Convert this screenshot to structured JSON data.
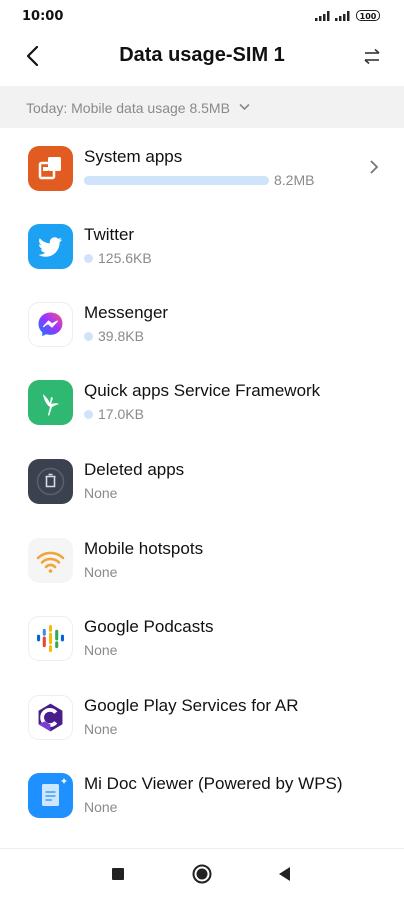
{
  "status_bar": {
    "time": "10:00",
    "battery": "100"
  },
  "header": {
    "title": "Data usage-SIM 1"
  },
  "summary": {
    "text": "Today: Mobile data usage 8.5MB"
  },
  "apps": [
    {
      "name": "System apps",
      "usage": "8.2MB",
      "icon": "system-apps-icon",
      "bar_fraction": 1.0
    },
    {
      "name": "Twitter",
      "usage": "125.6KB",
      "icon": "twitter-icon"
    },
    {
      "name": "Messenger",
      "usage": "39.8KB",
      "icon": "messenger-icon"
    },
    {
      "name": "Quick apps Service Framework",
      "usage": "17.0KB",
      "icon": "quick-apps-icon"
    },
    {
      "name": "Deleted apps",
      "usage": "None",
      "icon": "trash-icon"
    },
    {
      "name": "Mobile hotspots",
      "usage": "None",
      "icon": "wifi-hotspot-icon"
    },
    {
      "name": "Google Podcasts",
      "usage": "None",
      "icon": "google-podcasts-icon"
    },
    {
      "name": "Google Play Services for AR",
      "usage": "None",
      "icon": "arcore-icon"
    },
    {
      "name": "Mi Doc Viewer (Powered by WPS)",
      "usage": "None",
      "icon": "mi-doc-viewer-icon"
    }
  ],
  "colors": {
    "usage_bar": "#cfe4fb",
    "summary_bg": "#f2f2f2",
    "twitter": "#1da1f2",
    "quick_apps": "#2eb872"
  }
}
